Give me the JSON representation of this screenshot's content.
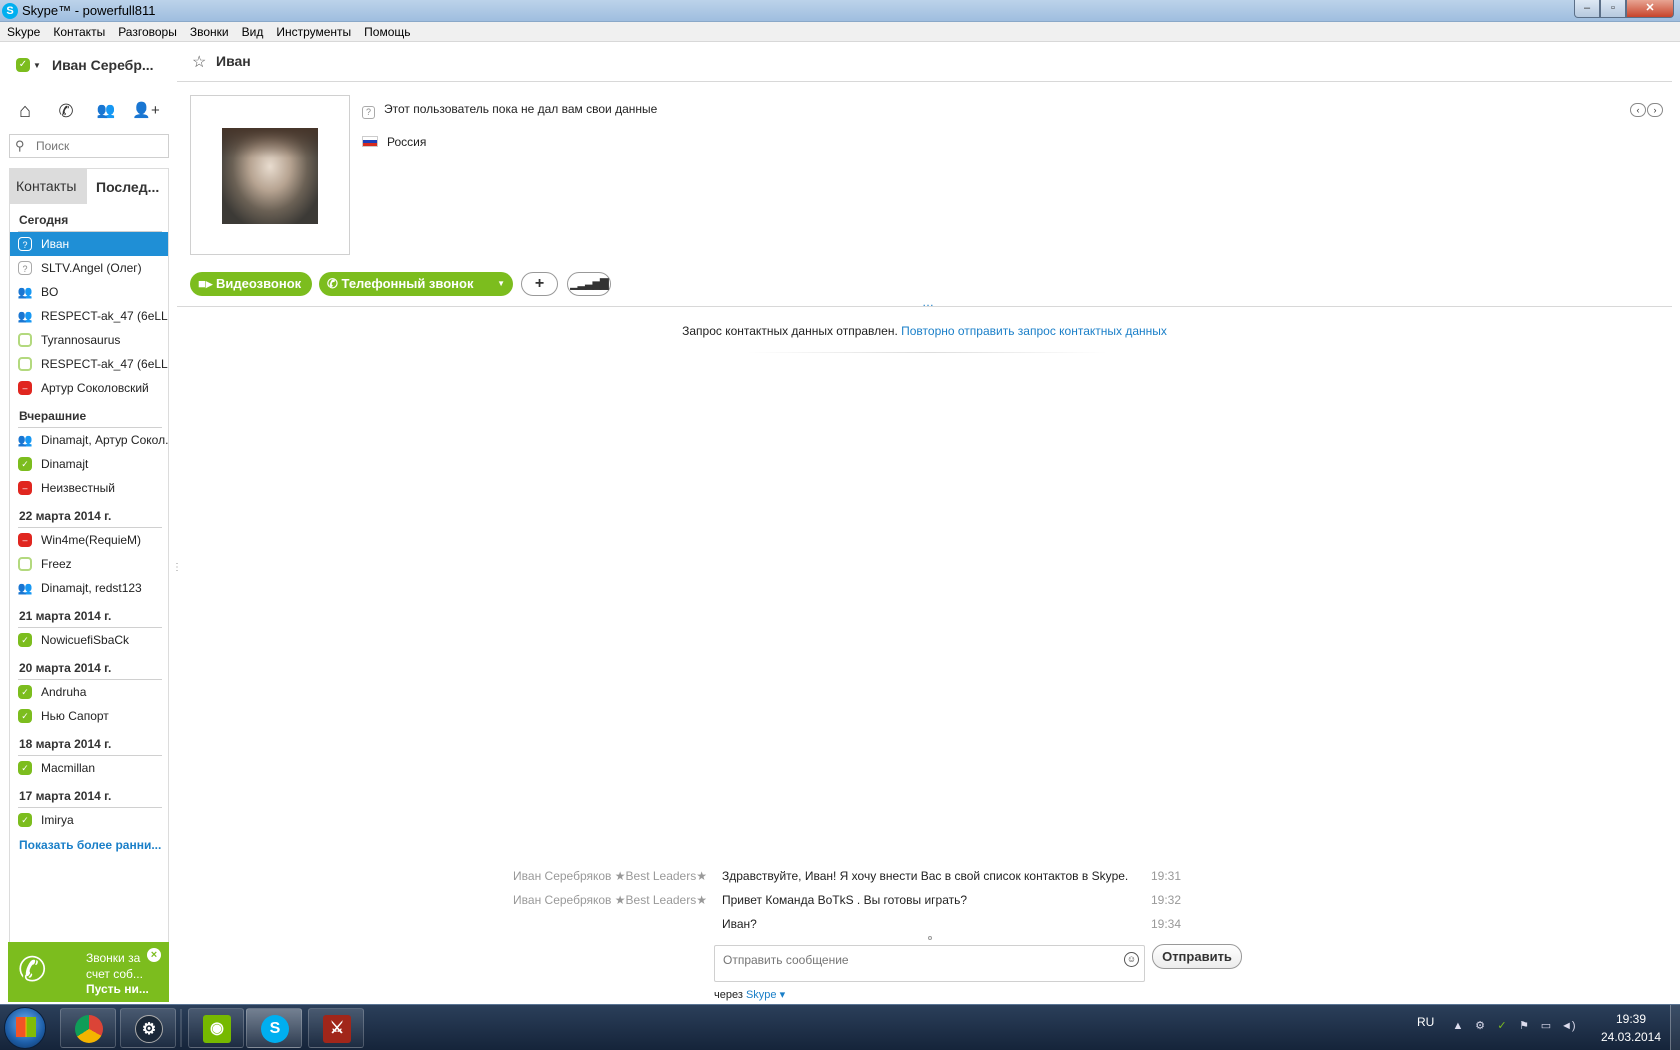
{
  "window": {
    "title": "Skype™ - powerfull811",
    "app_icon": "S",
    "min_icon": "‒",
    "max_icon": "▫",
    "close_icon": "✕"
  },
  "menu": [
    "Skype",
    "Контакты",
    "Разговоры",
    "Звонки",
    "Вид",
    "Инструменты",
    "Помощь"
  ],
  "profile": {
    "name": "Иван Серебр...",
    "status_icon": "skype-online-icon"
  },
  "search": {
    "placeholder": "Поиск"
  },
  "tabs": {
    "contacts": "Контакты",
    "recent": "Послед..."
  },
  "groups": [
    {
      "title": "Сегодня",
      "contacts": [
        {
          "name": "Иван",
          "status": "unknown",
          "selected": true
        },
        {
          "name": "SLTV.Angel (Олег)",
          "status": "unknown"
        },
        {
          "name": "BO",
          "status": "group"
        },
        {
          "name": "RESPECT-ak_47 (6eLLla...",
          "status": "group"
        },
        {
          "name": "Tyrannosaurus",
          "status": "offline"
        },
        {
          "name": "RESPECT-ak_47 (6eLLla...",
          "status": "offline"
        },
        {
          "name": "Артур Соколовский",
          "status": "dnd"
        }
      ]
    },
    {
      "title": "Вчерашние",
      "contacts": [
        {
          "name": "Dinamajt, Артур Сокол...",
          "status": "group"
        },
        {
          "name": "Dinamajt",
          "status": "online"
        },
        {
          "name": "Неизвестный",
          "status": "dnd"
        }
      ]
    },
    {
      "title": "22 марта 2014 г.",
      "contacts": [
        {
          "name": "Win4me(RequieM)",
          "status": "dnd"
        },
        {
          "name": "Freez",
          "status": "offline"
        },
        {
          "name": "Dinamajt, redst123",
          "status": "group"
        }
      ]
    },
    {
      "title": "21 марта 2014 г.",
      "contacts": [
        {
          "name": "NowicuefiSbaCk",
          "status": "online"
        }
      ]
    },
    {
      "title": "20 марта 2014 г.",
      "contacts": [
        {
          "name": "Andruha",
          "status": "online"
        },
        {
          "name": "Нью Сапорт",
          "status": "online"
        }
      ]
    },
    {
      "title": "18 марта 2014 г.",
      "contacts": [
        {
          "name": "Macmillan",
          "status": "online"
        }
      ]
    },
    {
      "title": "17 марта 2014 г.",
      "contacts": [
        {
          "name": "Imirya",
          "status": "online"
        }
      ]
    }
  ],
  "show_more": "Показать более ранни...",
  "promo": {
    "line1": "Звонки за счет соб...",
    "line2": "Пусть ни..."
  },
  "conversation": {
    "name": "Иван",
    "info_text": "Этот пользователь пока не дал вам свои данные",
    "country": "Россия",
    "video_call": "Видеозвонок",
    "phone_call": "Телефонный звонок",
    "notice_text": "Запрос контактных данных отправлен.",
    "notice_link": "Повторно отправить запрос контактных данных",
    "messages": [
      {
        "sender": "Иван Серебряков ★Best Leaders★",
        "text": "Здравствуйте, Иван! Я хочу внести Вас в свой список контактов в Skype.",
        "time": "19:31"
      },
      {
        "sender": "Иван Серебряков ★Best Leaders★",
        "text": "Привет Команда BoTkS . Вы готовы играть?",
        "time": "19:32"
      },
      {
        "sender": "",
        "text": "Иван?",
        "time": "19:34"
      }
    ],
    "composer_placeholder": "Отправить сообщение",
    "send_label": "Отправить",
    "via_label": "через",
    "via_service": "Skype"
  },
  "taskbar": {
    "language": "RU",
    "time": "19:39",
    "date": "24.03.2014",
    "apps": [
      "chrome-icon",
      "steam-icon",
      "nvidia-icon",
      "skype-icon",
      "dota2-icon"
    ]
  }
}
